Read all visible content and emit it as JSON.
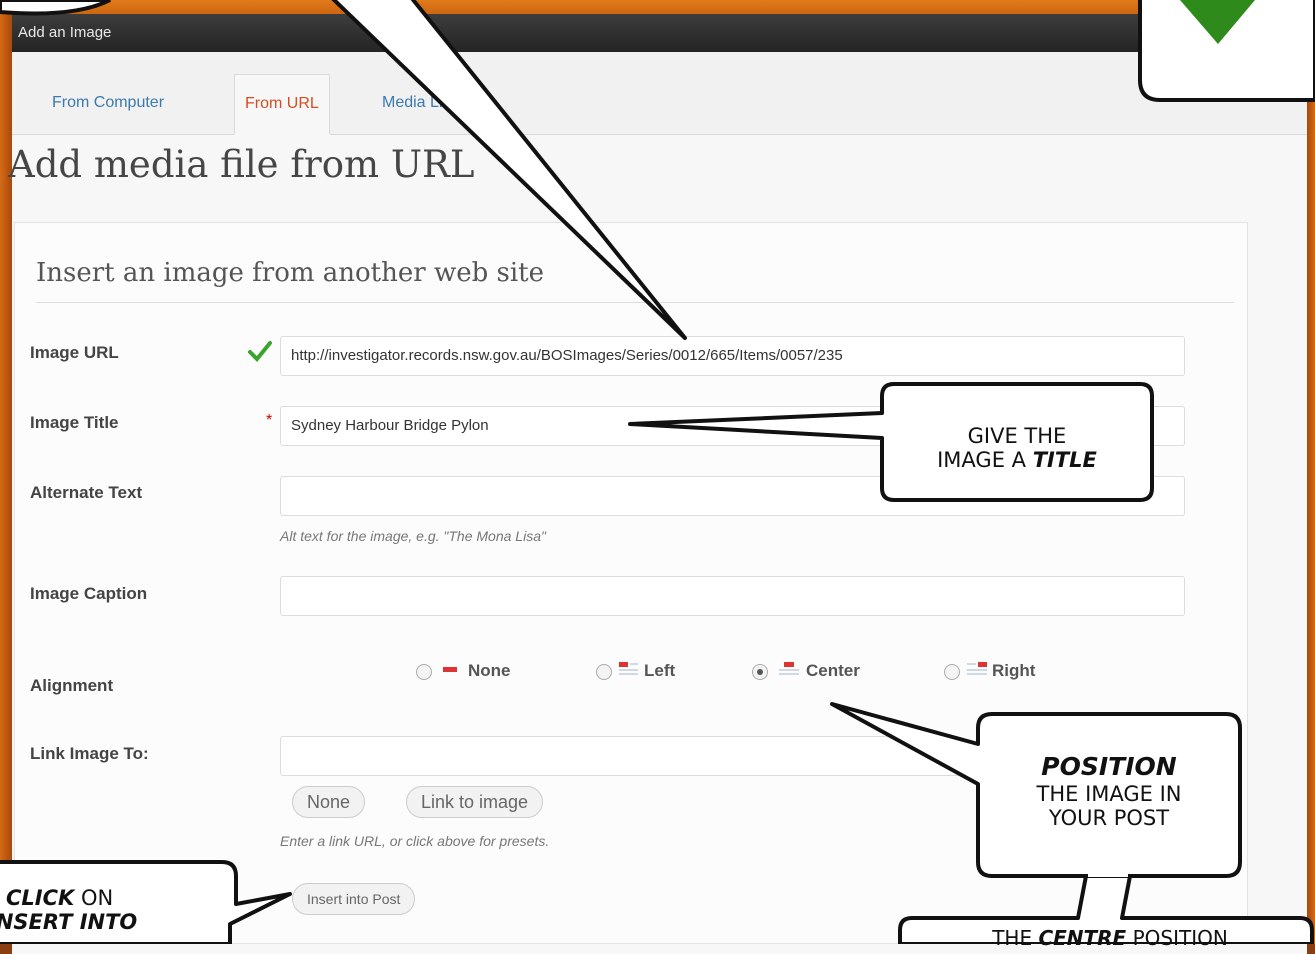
{
  "dialog": {
    "title": "Add an Image"
  },
  "tabs": [
    {
      "label": "From Computer",
      "active": false
    },
    {
      "label": "From URL",
      "active": true
    },
    {
      "label": "Media Libr",
      "active": false
    }
  ],
  "page_title": "Add media file from URL",
  "section_title": "Insert an image from another web site",
  "form": {
    "url_label": "Image URL",
    "url_value": "http://investigator.records.nsw.gov.au/BOSImages/Series/0012/665/Items/0057/235",
    "title_label": "Image Title",
    "title_required_mark": "*",
    "title_value": "Sydney Harbour Bridge Pylon",
    "alt_label": "Alternate Text",
    "alt_value": "",
    "alt_help": "Alt text for the image, e.g. \"The Mona Lisa\"",
    "caption_label": "Image Caption",
    "caption_value": "",
    "alignment_label": "Alignment",
    "alignment_options": [
      {
        "label": "None",
        "selected": false
      },
      {
        "label": "Left",
        "selected": false
      },
      {
        "label": "Center",
        "selected": true
      },
      {
        "label": "Right",
        "selected": false
      }
    ],
    "link_label": "Link Image To:",
    "link_value": "",
    "link_none_button": "None",
    "link_to_image_button": "Link to image",
    "link_help": "Enter a link URL, or click above for presets.",
    "insert_button": "Insert into Post"
  },
  "callouts": {
    "title_1": "Give the",
    "title_2_pre": "image a ",
    "title_2_em": "title",
    "position_1": "Position",
    "position_2": "the image in",
    "position_3": "your post",
    "click_1_em": "Click",
    "click_1_post": " on",
    "click_2": "Insert into",
    "centre_pre": "The ",
    "centre_em": "centre",
    "centre_post": " position"
  },
  "colors": {
    "frame": "#d56b14",
    "accent_tab": "#d54e21",
    "link": "#3b7ab0",
    "check": "#3aa52c",
    "arrow_badge": "#2f8a1c"
  },
  "icons": [
    "check-icon",
    "required-asterisk",
    "align-none-icon",
    "align-left-icon",
    "align-center-icon",
    "align-right-icon",
    "green-down-arrow-icon"
  ]
}
